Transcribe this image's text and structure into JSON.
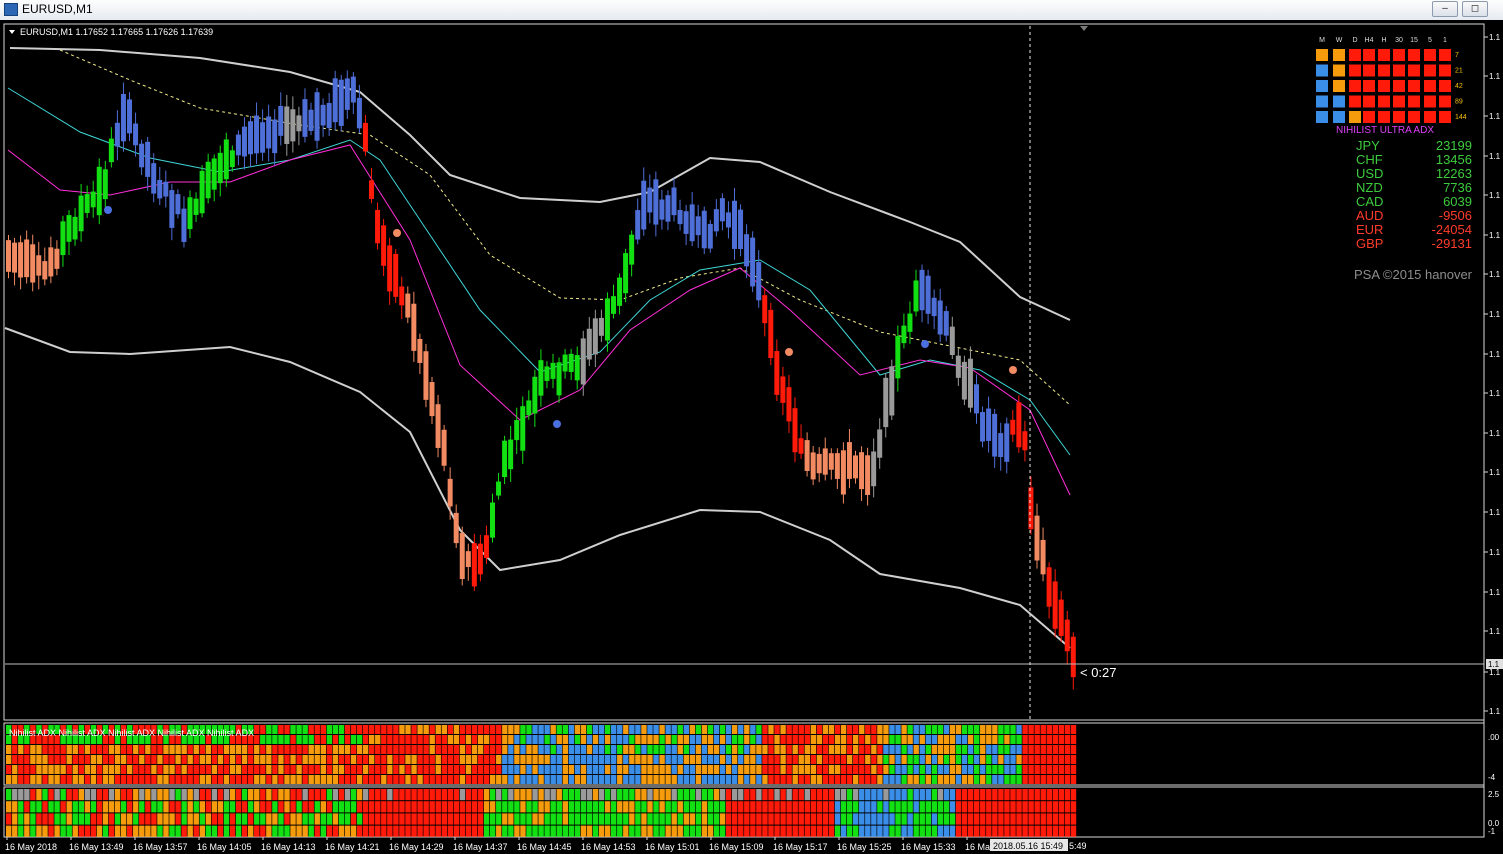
{
  "window": {
    "title": "EURUSD,M1",
    "minimize_label": "‒",
    "maximize_label": "◻"
  },
  "chart": {
    "header": "EURUSD,M1  1.17652 1.17665 1.17626 1.17639",
    "countdown": "< 0:27",
    "watermark": "PSA ©2015 hanover",
    "price_axis_label": "1.1",
    "time_labels": [
      "16 May 2018",
      "16 May 13:49",
      "16 May 13:57",
      "16 May 14:05",
      "16 May 14:13",
      "16 May 14:21",
      "16 May 14:29",
      "16 May 14:37",
      "16 May 14:45",
      "16 May 14:53",
      "16 May 15:01",
      "16 May 15:09",
      "16 May 15:17",
      "16 May 15:25",
      "16 May 15:33",
      "16 Ma"
    ],
    "time_crosshair_label": "2018.05.16 15:49",
    "time_crosshair_tail": "5:49"
  },
  "adx_panel": {
    "timeframes": [
      "M",
      "W",
      "D",
      "H4",
      "H",
      "30",
      "15",
      "5",
      "1"
    ],
    "periods": [
      "7",
      "21",
      "42",
      "89",
      "144"
    ],
    "title": "NIHILIST ULTRA ADX",
    "currencies": [
      {
        "name": "JPY",
        "value": "23199"
      },
      {
        "name": "CHF",
        "value": "13456"
      },
      {
        "name": "USD",
        "value": "12263"
      },
      {
        "name": "NZD",
        "value": "7736"
      },
      {
        "name": "CAD",
        "value": "6039"
      },
      {
        "name": "AUD",
        "value": "-9506"
      },
      {
        "name": "EUR",
        "value": "-24054"
      },
      {
        "name": "GBP",
        "value": "-29131"
      }
    ],
    "colors": {
      "positive": "#3ecb3e",
      "negative": "#ff3b2b"
    }
  },
  "subwindow1": {
    "label": "Nihilist ADX Nihilist ADX Nihilist ADX Nihilist ADX Nihilist ADX",
    "axis_top": ".00",
    "axis_bottom": "-4"
  },
  "subwindow2": {
    "axis_top": "2.5",
    "axis_mid": "0.0",
    "axis_bottom": "-1"
  },
  "colors": {
    "bull_green": "#12e012",
    "bear_red": "#ff1a0a",
    "salmon": "#f28a62",
    "blue": "#4f6fd8",
    "gray": "#9a9a9a",
    "orange": "#f59b0c",
    "sky": "#3b8ee8"
  }
}
